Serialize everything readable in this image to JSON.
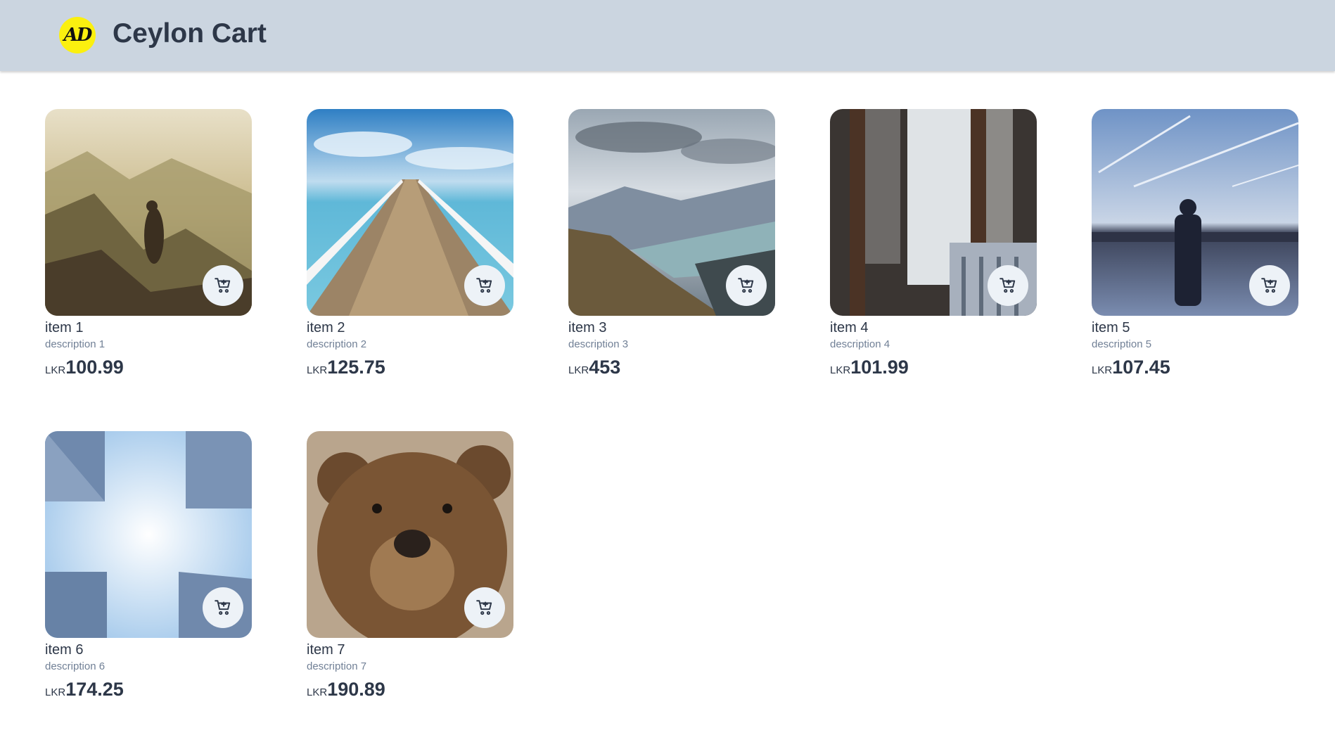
{
  "header": {
    "logo_text": "AD",
    "brand": "Ceylon Cart",
    "background": "#cbd5e0",
    "logo_color": "#fbf00f"
  },
  "products": [
    {
      "name": "item 1",
      "description": "description 1",
      "currency": "LKR",
      "price": "100.99",
      "image": "hiker-on-mountain",
      "cart_icon": "add-to-cart-icon"
    },
    {
      "name": "item 2",
      "description": "description 2",
      "currency": "LKR",
      "price": "125.75",
      "image": "pier-over-sea",
      "cart_icon": "add-to-cart-icon"
    },
    {
      "name": "item 3",
      "description": "description 3",
      "currency": "LKR",
      "price": "453",
      "image": "mountain-lake-valley",
      "cart_icon": "add-to-cart-icon"
    },
    {
      "name": "item 4",
      "description": "description 4",
      "currency": "LKR",
      "price": "101.99",
      "image": "window-curtain-chair",
      "cart_icon": "add-to-cart-icon"
    },
    {
      "name": "item 5",
      "description": "description 5",
      "currency": "LKR",
      "price": "107.45",
      "image": "man-by-lake",
      "cart_icon": "add-to-cart-icon"
    },
    {
      "name": "item 6",
      "description": "description 6",
      "currency": "LKR",
      "price": "174.25",
      "image": "buildings-sky",
      "cart_icon": "add-to-cart-icon"
    },
    {
      "name": "item 7",
      "description": "description 7",
      "currency": "LKR",
      "price": "190.89",
      "image": "brown-bear",
      "cart_icon": "add-to-cart-icon"
    }
  ]
}
